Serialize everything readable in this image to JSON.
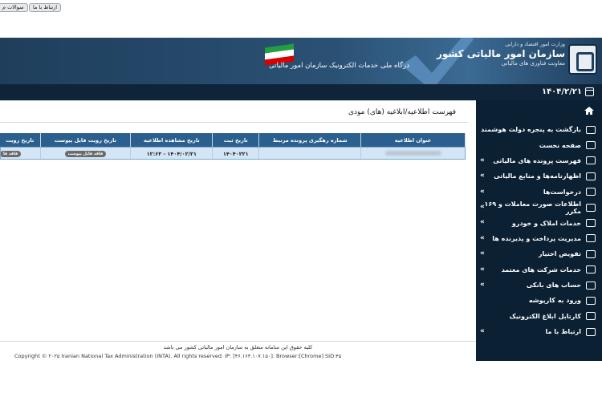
{
  "header": {
    "ministry": "وزارت امور اقتصاد و دارایی",
    "org_name": "سازمان امور مالیاتی کشور",
    "deputy": "معاونت فناوری های مالیاتی",
    "portal_title": "درگاه ملی خدمات الکترونیک سازمان امور مالیاتی",
    "date": "۱۴۰۴/۲/۲۱"
  },
  "topbar": {
    "contact_label": "ارتباط با ما",
    "faq_label": "سوالات م"
  },
  "sidebar": {
    "items": [
      {
        "label": "بازگشت به پنجره دولت هوشمند",
        "icon": "back-icon",
        "arrow": false
      },
      {
        "label": "صفحه نخست",
        "icon": "dashboard-icon",
        "arrow": false
      },
      {
        "label": "فهرست پرونده های مالیاتی",
        "icon": "building-icon",
        "arrow": true
      },
      {
        "label": "اظهارنامه‌ها و منابع مالیاتی",
        "icon": "document-icon",
        "arrow": true
      },
      {
        "label": "درخواست‌ها",
        "icon": "checklist-icon",
        "arrow": true
      },
      {
        "label": "اطلاعات صورت معاملات و ۱۶۹ مکرر",
        "icon": "invoice-icon",
        "arrow": true
      },
      {
        "label": "خدمات املاک و خودرو",
        "icon": "car-icon",
        "arrow": true
      },
      {
        "label": "مدیریت پرداخت و پذیرنده ها",
        "icon": "card-icon",
        "arrow": true
      },
      {
        "label": "تفویض اختیار",
        "icon": "delegate-icon",
        "arrow": true
      },
      {
        "label": "خدمات شرکت های معتمد",
        "icon": "badge-icon",
        "arrow": true
      },
      {
        "label": "حساب های بانکی",
        "icon": "bank-card-icon",
        "arrow": true
      },
      {
        "label": "ورود به کارپوشه",
        "icon": "folder-icon",
        "arrow": false
      },
      {
        "label": "کارتابل ابلاغ الکترونیک",
        "icon": "inbox-icon",
        "arrow": false
      },
      {
        "label": "ارتباط با ما",
        "icon": "mail-icon",
        "arrow": true
      }
    ]
  },
  "main": {
    "title": "فهرست اطلاعیه/ابلاغیه (های) مودی",
    "columns": [
      "عنوان اطلاعیه",
      "شماره رهگیری پرونده مرتبط",
      "تاریخ ثبت",
      "تاریخ مشاهده اطلاعیه",
      "تاریخ رویت فایل پیوست",
      "تاریخ رویت"
    ],
    "rows": [
      {
        "subject": "",
        "tracking": "",
        "registered": "۱۴۰۴۰۲۲۱",
        "viewed": "۱۴۰۴/۰۲/۲۱ - ۱۲:۶۳",
        "attachment_badge": "فاقد فایل پیوست",
        "last_badge": "فاقد فا"
      }
    ]
  },
  "footer": {
    "rights": "کلیه حقوق این سامانه متعلق به سازمان امور مالیاتی کشور می باشد",
    "copyright": "Copyright © ۲۰۲۵ Iranian National Tax Administration (INTA). All rights reserved. IP: [۴۶.۱۶۴.۱۰۷.۱۵۰]. Browser:[Chrome] SID:۴۵"
  }
}
